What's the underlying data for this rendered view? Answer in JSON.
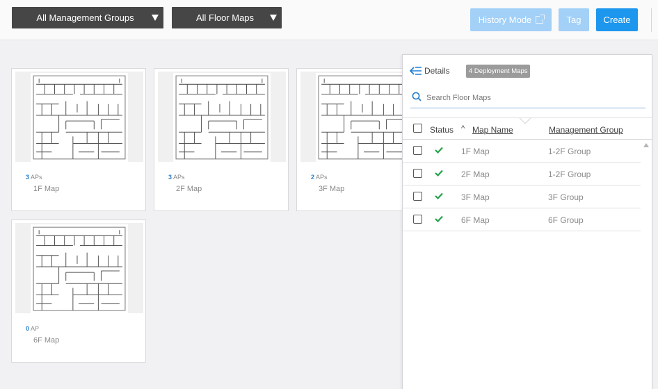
{
  "topbar": {
    "management_groups": "All Management Groups",
    "floor_maps": "All Floor Maps",
    "history_mode": "History Mode",
    "tag": "Tag",
    "create": "Create"
  },
  "cards": [
    {
      "ap_count": "3",
      "ap_unit": "APs",
      "name": "1F Map"
    },
    {
      "ap_count": "3",
      "ap_unit": "APs",
      "name": "2F Map"
    },
    {
      "ap_count": "2",
      "ap_unit": "APs",
      "name": "3F Map"
    },
    {
      "ap_count": "0",
      "ap_unit": "AP",
      "name": "6F Map"
    }
  ],
  "details": {
    "title": "Details",
    "badge": "4 Deployment Maps",
    "search_placeholder": "Search Floor Maps",
    "columns": {
      "status": "Status",
      "sort_indicator": "^",
      "map_name": "Map Name",
      "management_group": "Management Group"
    },
    "rows": [
      {
        "map": "1F Map",
        "group": "1-2F Group"
      },
      {
        "map": "2F Map",
        "group": "1-2F Group"
      },
      {
        "map": "3F Map",
        "group": "3F Group"
      },
      {
        "map": "6F Map",
        "group": "6F Group"
      }
    ]
  },
  "colors": {
    "accent": "#1d96ee",
    "disabled_button": "#a2d0f7",
    "status_ok": "#22a34a",
    "dropdown": "#464646"
  }
}
